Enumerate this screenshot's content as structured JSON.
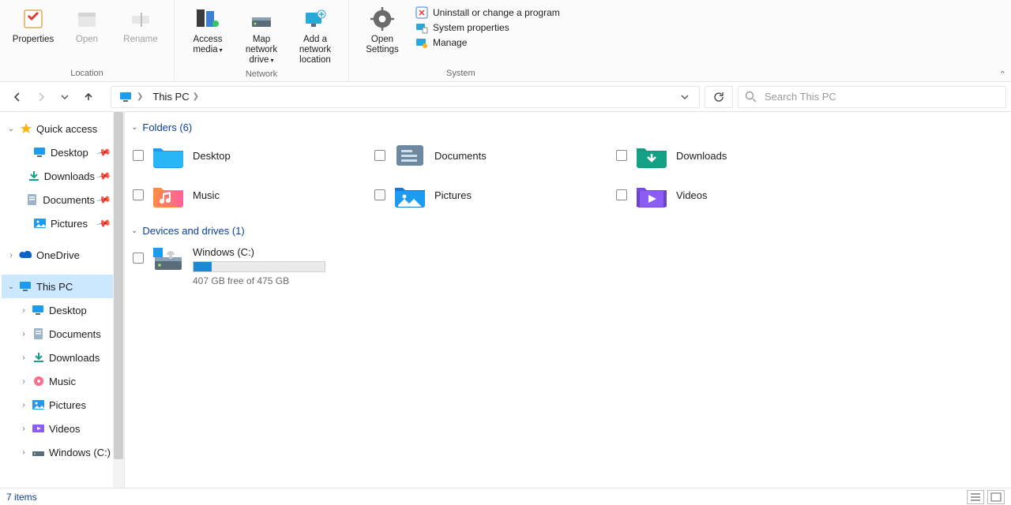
{
  "ribbon": {
    "groups": {
      "location": {
        "label": "Location",
        "items": {
          "properties": "Properties",
          "open": "Open",
          "rename": "Rename"
        }
      },
      "network": {
        "label": "Network",
        "items": {
          "access_media": "Access media",
          "map_drive": "Map network drive",
          "add_location": "Add a network location"
        }
      },
      "system": {
        "label": "System",
        "items": {
          "open_settings": "Open Settings",
          "uninstall": "Uninstall or change a program",
          "sysprops": "System properties",
          "manage": "Manage"
        }
      }
    }
  },
  "nav": {
    "breadcrumb": {
      "root_icon": "this-pc",
      "current": "This PC"
    },
    "search_placeholder": "Search This PC"
  },
  "sidebar": [
    {
      "id": "quick-access",
      "label": "Quick access",
      "icon": "star",
      "expand": "open",
      "indent": 0
    },
    {
      "id": "qa-desktop",
      "label": "Desktop",
      "icon": "desktop",
      "pinned": true,
      "indent": 1
    },
    {
      "id": "qa-downloads",
      "label": "Downloads",
      "icon": "download",
      "pinned": true,
      "indent": 1
    },
    {
      "id": "qa-documents",
      "label": "Documents",
      "icon": "doc",
      "pinned": true,
      "indent": 1
    },
    {
      "id": "qa-pictures",
      "label": "Pictures",
      "icon": "picture",
      "pinned": true,
      "indent": 1
    },
    {
      "id": "onedrive",
      "label": "OneDrive",
      "icon": "cloud",
      "expand": "closed",
      "indent": 0
    },
    {
      "id": "this-pc",
      "label": "This PC",
      "icon": "pc",
      "expand": "open",
      "indent": 0,
      "selected": true
    },
    {
      "id": "pc-desktop",
      "label": "Desktop",
      "icon": "desktop",
      "expand": "closed",
      "indent": 2
    },
    {
      "id": "pc-documents",
      "label": "Documents",
      "icon": "doc",
      "expand": "closed",
      "indent": 2
    },
    {
      "id": "pc-downloads",
      "label": "Downloads",
      "icon": "download",
      "expand": "closed",
      "indent": 2
    },
    {
      "id": "pc-music",
      "label": "Music",
      "icon": "music",
      "expand": "closed",
      "indent": 2
    },
    {
      "id": "pc-pictures",
      "label": "Pictures",
      "icon": "picture",
      "expand": "closed",
      "indent": 2
    },
    {
      "id": "pc-videos",
      "label": "Videos",
      "icon": "video",
      "expand": "closed",
      "indent": 2
    },
    {
      "id": "pc-cdrive",
      "label": "Windows (C:)",
      "icon": "drive",
      "expand": "closed",
      "indent": 2
    }
  ],
  "content": {
    "folders_header": "Folders (6)",
    "folders": [
      {
        "id": "desktop",
        "label": "Desktop",
        "icon": "desktop-folder"
      },
      {
        "id": "documents",
        "label": "Documents",
        "icon": "documents-folder"
      },
      {
        "id": "downloads",
        "label": "Downloads",
        "icon": "downloads-folder"
      },
      {
        "id": "music",
        "label": "Music",
        "icon": "music-folder"
      },
      {
        "id": "pictures",
        "label": "Pictures",
        "icon": "pictures-folder"
      },
      {
        "id": "videos",
        "label": "Videos",
        "icon": "videos-folder"
      }
    ],
    "drives_header": "Devices and drives (1)",
    "drives": [
      {
        "id": "c",
        "label": "Windows (C:)",
        "free_text": "407 GB free of 475 GB",
        "used_pct": 14
      }
    ]
  },
  "status": {
    "items": "7 items"
  }
}
